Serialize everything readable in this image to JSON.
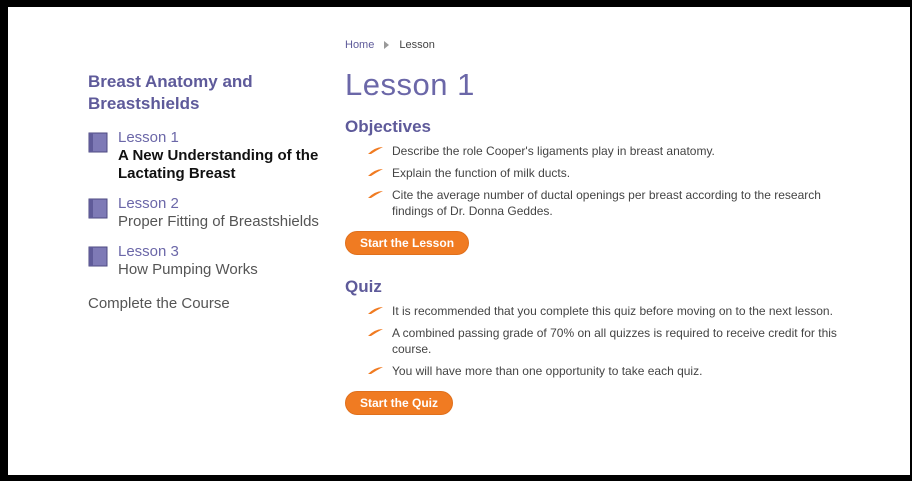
{
  "sidebar": {
    "course_title": "Breast Anatomy and Breastshields",
    "lessons": [
      {
        "number": "Lesson 1",
        "title": "A New Understanding of the Lactating Breast"
      },
      {
        "number": "Lesson 2",
        "title": "Proper Fitting of Breastshields"
      },
      {
        "number": "Lesson 3",
        "title": "How Pumping Works"
      }
    ],
    "complete_course": "Complete the Course"
  },
  "breadcrumb": {
    "home": "Home",
    "current": "Lesson"
  },
  "main": {
    "title": "Lesson 1",
    "objectives": {
      "heading": "Objectives",
      "items": [
        "Describe the role Cooper's ligaments play in breast anatomy.",
        "Explain the function of milk ducts.",
        "Cite the average number of ductal openings per breast according to the research findings of Dr. Donna Geddes."
      ],
      "button": "Start the Lesson"
    },
    "quiz": {
      "heading": "Quiz",
      "items": [
        "It is recommended that you complete this quiz before moving on to the next lesson.",
        "A combined passing grade of 70% on all quizzes is required to receive credit for this course.",
        "You will have more than one opportunity to take each quiz."
      ],
      "button": "Start the Quiz"
    }
  },
  "colors": {
    "accent_purple": "#5e5a9a",
    "button_orange": "#f07b22"
  },
  "icons": {
    "lesson": "book-icon",
    "bullet": "orange-swoosh-bullet-icon",
    "breadcrumb_separator": "triangle-right-icon"
  }
}
